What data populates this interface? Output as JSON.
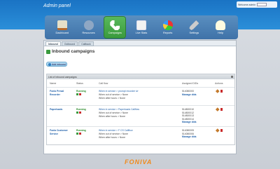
{
  "header": {
    "title": "Admin panel",
    "welcome": "Welcome admin"
  },
  "nav": [
    {
      "label": "Dashboard",
      "icon": "home-icon"
    },
    {
      "label": "Resources",
      "icon": "users-icon"
    },
    {
      "label": "Campaigns",
      "icon": "phone-icon",
      "active": true
    },
    {
      "label": "Live Stats",
      "icon": "chart-window-icon"
    },
    {
      "label": "Reports",
      "icon": "pie-chart-icon"
    },
    {
      "label": "Settings",
      "icon": "tools-icon"
    },
    {
      "label": "Help",
      "icon": "lightbulb-icon"
    }
  ],
  "tabs": [
    "Inbound",
    "Outbound",
    "Callback"
  ],
  "page": {
    "title": "Inbound campaigns",
    "add_button": "Add inbound",
    "list_title": "List of inbound campaigns"
  },
  "table": {
    "columns": [
      "Name",
      "Status",
      "Call flow",
      "Assigned DIDs",
      "Actions"
    ],
    "rows": [
      {
        "name": "Fonia Presal Recorder",
        "status": "Running",
        "flow": [
          "When in service > prompt recorder ivr",
          "When out of service > None",
          "When after hours > None"
        ],
        "dids": [
          "514080000"
        ],
        "manage": "Manage dids"
      },
      {
        "name": "Paperloads",
        "status": "Running",
        "flow": [
          "When in service > Paperloads Callflow",
          "When out of service > None",
          "When after hours > None"
        ],
        "dids": [
          "514800010",
          "514800012",
          "514800013",
          "514800014"
        ],
        "manage": "Manage dids"
      },
      {
        "name": "Fonia Customer Service",
        "status": "Running",
        "flow": [
          "When in service > F CS Callflow",
          "When out of service > None",
          "When after hours > None"
        ],
        "dids": [
          "514080005",
          "514080006"
        ],
        "manage": "Manage dids"
      }
    ]
  },
  "footer": {
    "brand": "FONIVA"
  }
}
